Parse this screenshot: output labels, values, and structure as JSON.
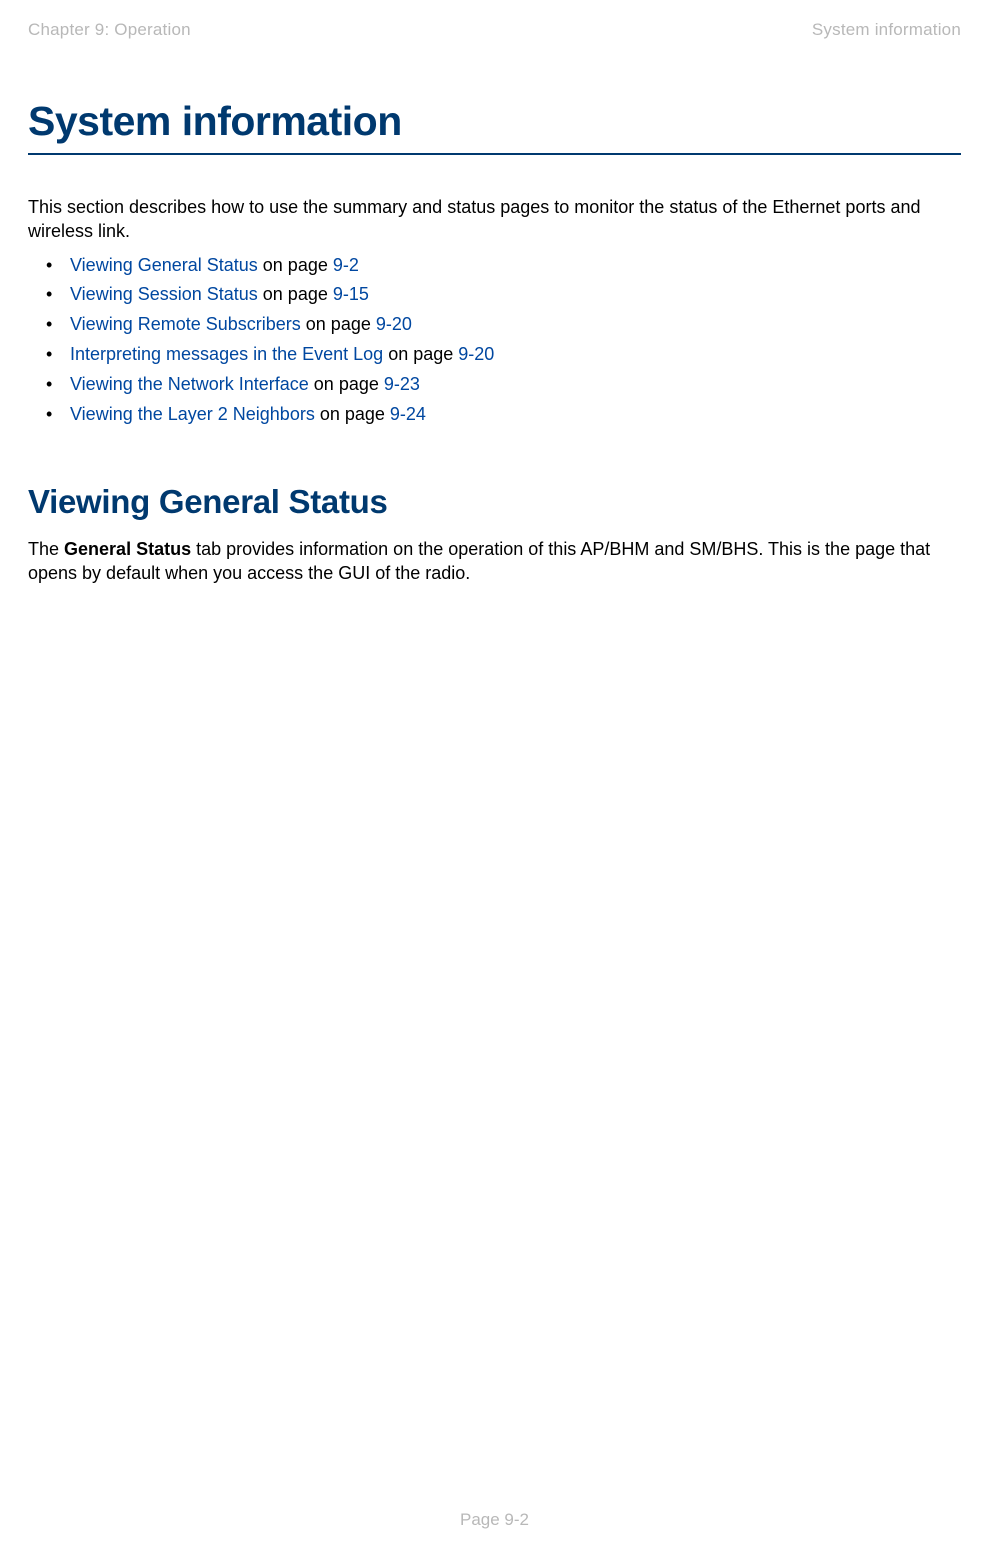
{
  "header": {
    "left": "Chapter 9:  Operation",
    "right": "System information"
  },
  "h1": "System information",
  "intro": "This section describes how to use the summary and status pages to monitor the status of the Ethernet ports and wireless link.",
  "toc": [
    {
      "link": "Viewing General Status",
      "mid": " on page ",
      "page": "9-2"
    },
    {
      "link": "Viewing Session Status",
      "mid": " on page ",
      "page": "9-15"
    },
    {
      "link": "Viewing Remote Subscribers",
      "mid": " on page ",
      "page": "9-20"
    },
    {
      "link": "Interpreting messages in the Event Log",
      "mid": " on page ",
      "page": "9-20"
    },
    {
      "link": "Viewing the Network Interface",
      "mid": " on page ",
      "page": "9-23"
    },
    {
      "link": "Viewing the Layer 2 Neighbors",
      "mid": " on page ",
      "page": "9-24"
    }
  ],
  "h2": "Viewing General Status",
  "body": {
    "lead": "The ",
    "bold": "General Status",
    "rest": " tab provides information on the operation of this AP/BHM and SM/BHS. This is the page that opens by default when you access the GUI of the radio."
  },
  "footer": "Page 9-2"
}
